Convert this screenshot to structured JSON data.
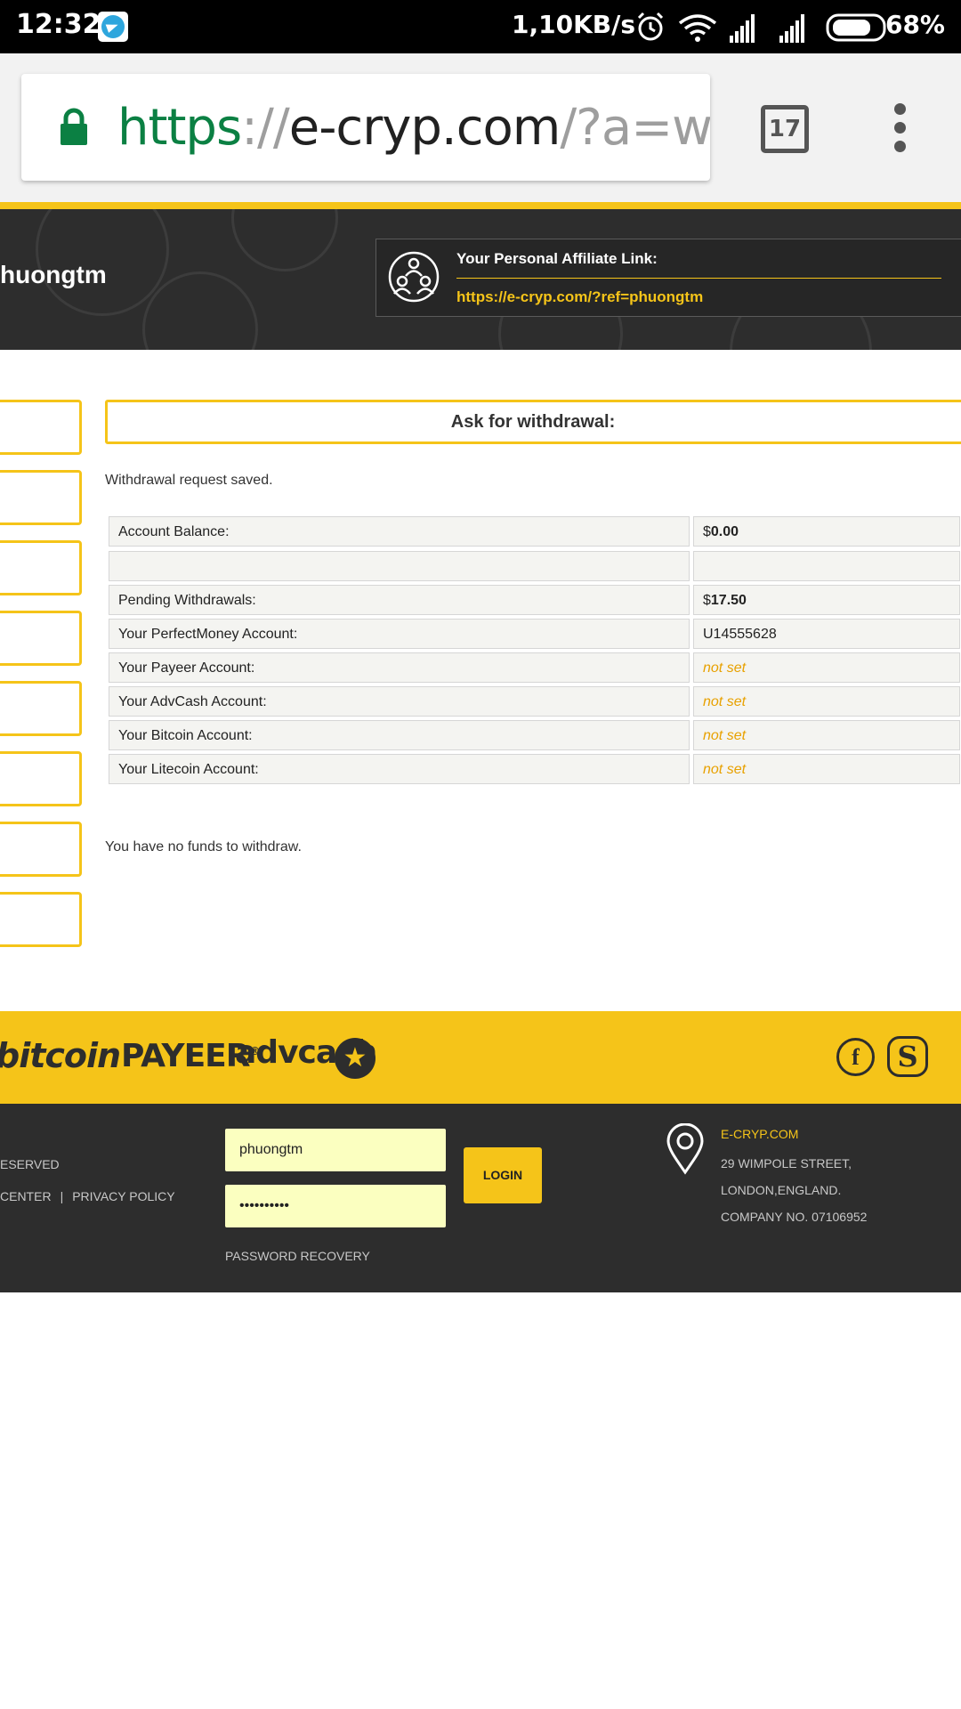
{
  "status_bar": {
    "time": "12:32",
    "speed": "1,10KB/s",
    "battery": "68%",
    "icons": [
      "telegram-icon",
      "alarm-icon",
      "wifi-icon",
      "signal-icon",
      "signal-icon",
      "battery-icon"
    ]
  },
  "browser": {
    "url_scheme": "https",
    "url_sep": "://",
    "url_host": "e-cryp.com",
    "url_path": "/?a=with",
    "tab_count": "17"
  },
  "header": {
    "username": "huongtm",
    "affiliate_label": "Your Personal Affiliate Link:",
    "affiliate_link": "https://e-cryp.com/?ref=phuongtm"
  },
  "main": {
    "title": "Ask for withdrawal:",
    "saved_message": "Withdrawal request saved.",
    "rows": [
      {
        "label": "Account Balance:",
        "currency": "$",
        "value": "0.00",
        "type": "amount"
      },
      {
        "label": "",
        "value": "",
        "type": "empty"
      },
      {
        "label": "Pending Withdrawals:",
        "currency": "$",
        "value": "17.50",
        "type": "amount"
      },
      {
        "label": "Your PerfectMoney Account:",
        "value": "U14555628",
        "type": "text"
      },
      {
        "label": "Your Payeer Account:",
        "value": "not set",
        "type": "notset"
      },
      {
        "label": "Your AdvCash Account:",
        "value": "not set",
        "type": "notset"
      },
      {
        "label": "Your Bitcoin Account:",
        "value": "not set",
        "type": "notset"
      },
      {
        "label": "Your Litecoin Account:",
        "value": "not set",
        "type": "notset"
      }
    ],
    "no_funds": "You have no funds to withdraw."
  },
  "payments": {
    "bitcoin": "bitcoin",
    "payeer": "PAYEER",
    "payeer_mark": "®",
    "advcash": "advcash",
    "advcash_symbol": "★",
    "facebook": "f",
    "skype": "S"
  },
  "footer": {
    "reserved": "ESERVED",
    "link_center": "CENTER",
    "link_separator": "|",
    "link_privacy": "PRIVACY POLICY",
    "username_value": "phuongtm",
    "password_value": "••••••••••",
    "login_label": "LOGIN",
    "password_recovery": "PASSWORD RECOVERY",
    "company_name": "E-CRYP.COM",
    "address_1": "29 WIMPOLE STREET,",
    "address_2": "LONDON,ENGLAND.",
    "address_3": "COMPANY NO. 07106952"
  },
  "colors": {
    "accent_yellow": "#f5c419",
    "dark_band": "#2d2d2d",
    "url_scheme_green": "#0b8043",
    "not_set_orange": "#e8a100",
    "login_field_bg": "#fbffc0"
  }
}
